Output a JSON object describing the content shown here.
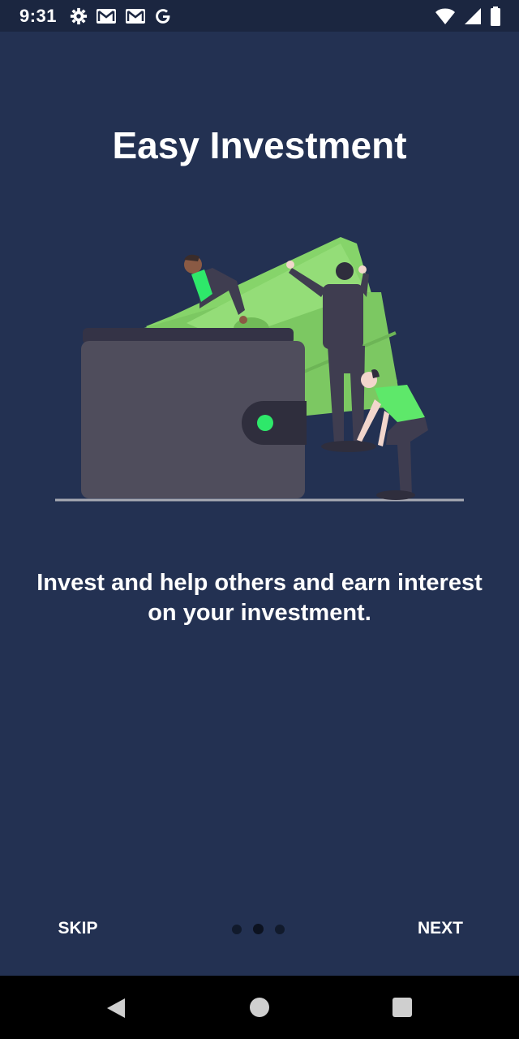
{
  "status_bar": {
    "time": "9:31",
    "left_icons": [
      "settings-icon",
      "gmail-icon",
      "gmail-icon",
      "google-icon"
    ],
    "right_icons": [
      "wifi-icon",
      "cellular-signal-icon",
      "battery-icon"
    ]
  },
  "onboarding": {
    "title": "Easy Investment",
    "description": "Invest and help others and earn interest on your investment.",
    "skip_label": "SKIP",
    "next_label": "NEXT",
    "page_count": 3,
    "current_page": 2
  },
  "colors": {
    "background": "#233152",
    "status_bar": "#1b2640",
    "accent_green": "#2ee86a",
    "money_green": "#86d46a",
    "wallet": "#4f4d5c"
  },
  "nav_bar": {
    "icons": [
      "back-icon",
      "home-icon",
      "recents-icon"
    ]
  }
}
